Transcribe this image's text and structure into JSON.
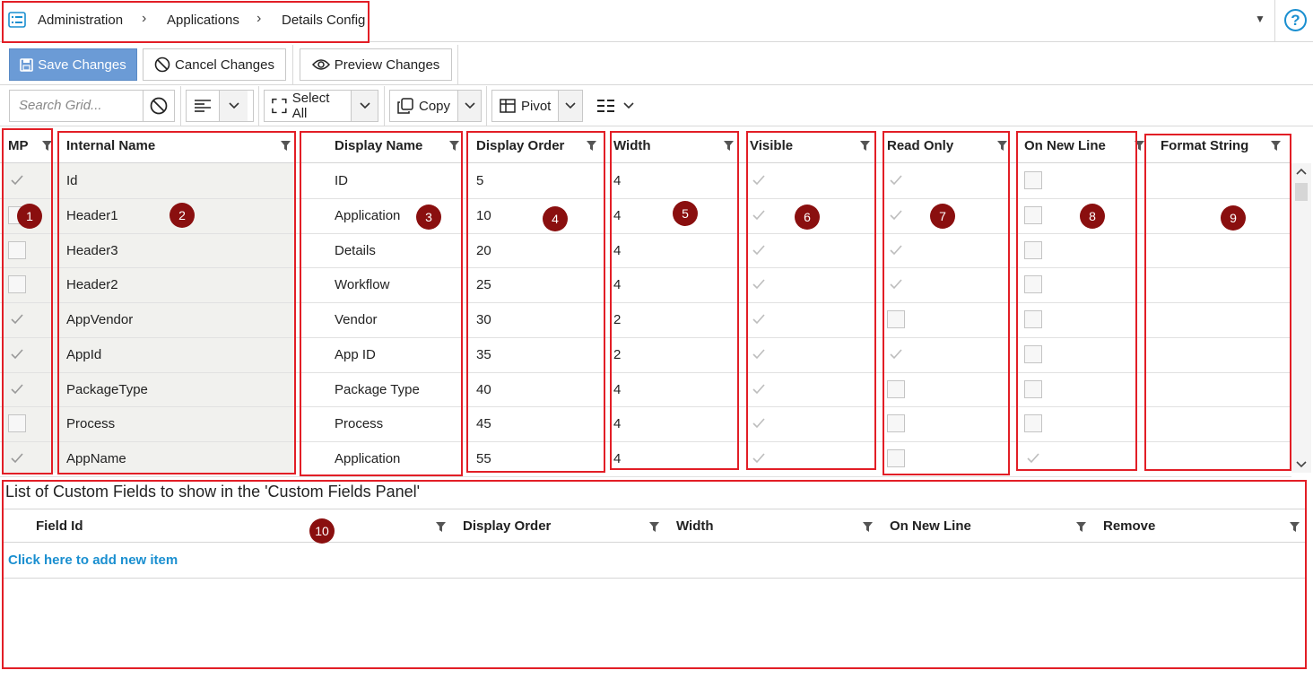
{
  "breadcrumb": [
    "Administration",
    "Applications",
    "Details Config"
  ],
  "help_label": "?",
  "toolbar": {
    "save": "Save Changes",
    "cancel": "Cancel Changes",
    "preview": "Preview Changes"
  },
  "grid_toolbar": {
    "search_placeholder": "Search Grid...",
    "select_all": "Select All",
    "copy": "Copy",
    "pivot": "Pivot"
  },
  "columns": [
    "MP",
    "Internal Name",
    "Display Name",
    "Display Order",
    "Width",
    "Visible",
    "Read Only",
    "On New Line",
    "Format String"
  ],
  "rows": [
    {
      "mp": true,
      "internal": "Id",
      "display": "ID",
      "order": "5",
      "width": "4",
      "visible": true,
      "readonly": true,
      "newline": false,
      "format": ""
    },
    {
      "mp": false,
      "internal": "Header1",
      "display": "Application",
      "order": "10",
      "width": "4",
      "visible": true,
      "readonly": true,
      "newline": false,
      "format": ""
    },
    {
      "mp": false,
      "internal": "Header3",
      "display": "Details",
      "order": "20",
      "width": "4",
      "visible": true,
      "readonly": true,
      "newline": false,
      "format": ""
    },
    {
      "mp": false,
      "internal": "Header2",
      "display": "Workflow",
      "order": "25",
      "width": "4",
      "visible": true,
      "readonly": true,
      "newline": false,
      "format": ""
    },
    {
      "mp": true,
      "internal": "AppVendor",
      "display": "Vendor",
      "order": "30",
      "width": "2",
      "visible": true,
      "readonly": false,
      "newline": false,
      "format": ""
    },
    {
      "mp": true,
      "internal": "AppId",
      "display": "App ID",
      "order": "35",
      "width": "2",
      "visible": true,
      "readonly": true,
      "newline": false,
      "format": ""
    },
    {
      "mp": true,
      "internal": "PackageType",
      "display": "Package Type",
      "order": "40",
      "width": "4",
      "visible": true,
      "readonly": false,
      "newline": false,
      "format": ""
    },
    {
      "mp": false,
      "internal": "Process",
      "display": "Process",
      "order": "45",
      "width": "4",
      "visible": true,
      "readonly": false,
      "newline": false,
      "format": ""
    },
    {
      "mp": true,
      "internal": "AppName",
      "display": "Application",
      "order": "55",
      "width": "4",
      "visible": true,
      "readonly": false,
      "newline": true,
      "format": ""
    }
  ],
  "badges": [
    "1",
    "2",
    "3",
    "4",
    "5",
    "6",
    "7",
    "8",
    "9",
    "10"
  ],
  "custom_fields": {
    "title": "List of Custom Fields to show in the 'Custom Fields Panel'",
    "columns": [
      "Field Id",
      "Display Order",
      "Width",
      "On New Line",
      "Remove"
    ],
    "add_link": "Click here to add new item"
  },
  "colors": {
    "accent": "#1a8fd0",
    "primary_button": "#6b9bd6",
    "annotation_red": "#e21e26",
    "badge": "#8a0f0f"
  }
}
